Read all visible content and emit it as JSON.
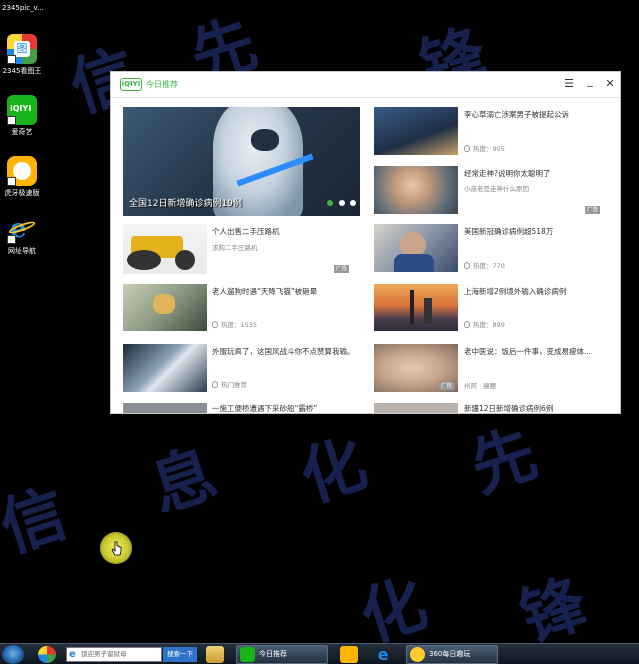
{
  "desktop": {
    "top_file_label": "2345pic_v...",
    "icons": [
      {
        "label": "2345看图王",
        "icon": "image-viewer-icon"
      },
      {
        "label": "爱奇艺",
        "icon": "iqiyi-icon"
      },
      {
        "label": "虎牙极速版",
        "icon": "huya-icon"
      },
      {
        "label": "网址导航",
        "icon": "ie-icon"
      }
    ],
    "watermark_chars": [
      "信",
      "息",
      "化",
      "先",
      "锋"
    ]
  },
  "window": {
    "logo_text": "iQIYI",
    "title": "今日推荐",
    "controls": {
      "menu": "☰",
      "minimize": "_",
      "close": "✕"
    }
  },
  "feed": {
    "hero": {
      "caption": "全国12日新增确诊病例19例"
    },
    "items": [
      {
        "title": "李心草溺亡涉案男子被提起公诉",
        "meta": "热度：905"
      },
      {
        "title": "经常走神?说明你太聪明了",
        "meta": "小孩老是走神什么原因",
        "ad": "广告"
      },
      {
        "title": "个人出售二手压路机",
        "meta": "求购二手压路机",
        "ad": "广告"
      },
      {
        "title": "美国新冠确诊病例超518万",
        "meta": "热度：770"
      },
      {
        "title": "老人遛狗时遇“天降飞猫”被砸晕",
        "meta": "热度：1535"
      },
      {
        "title": "上海新增2例境外输入确诊病例",
        "meta": "热度：899"
      },
      {
        "title": "外服玩疯了，这国风战斗你不点赞算我输。",
        "meta": "热门推荐"
      },
      {
        "title": "老中医说：饭后一件事，变成易瘦体...",
        "meta": "州阿 · 瘦腰",
        "ad": "广告"
      },
      {
        "title": "一施工便桥遭遇下采砂船“霸桥”",
        "meta": ""
      },
      {
        "title": "新疆12日新增确诊病例6例",
        "meta": ""
      }
    ]
  },
  "taskbar": {
    "search_placeholder": "锁迎男子留狱母",
    "search_button": "搜索一下",
    "tasks": [
      {
        "label": "今日推荐"
      },
      {
        "label": "360每日趣玩"
      }
    ]
  }
}
